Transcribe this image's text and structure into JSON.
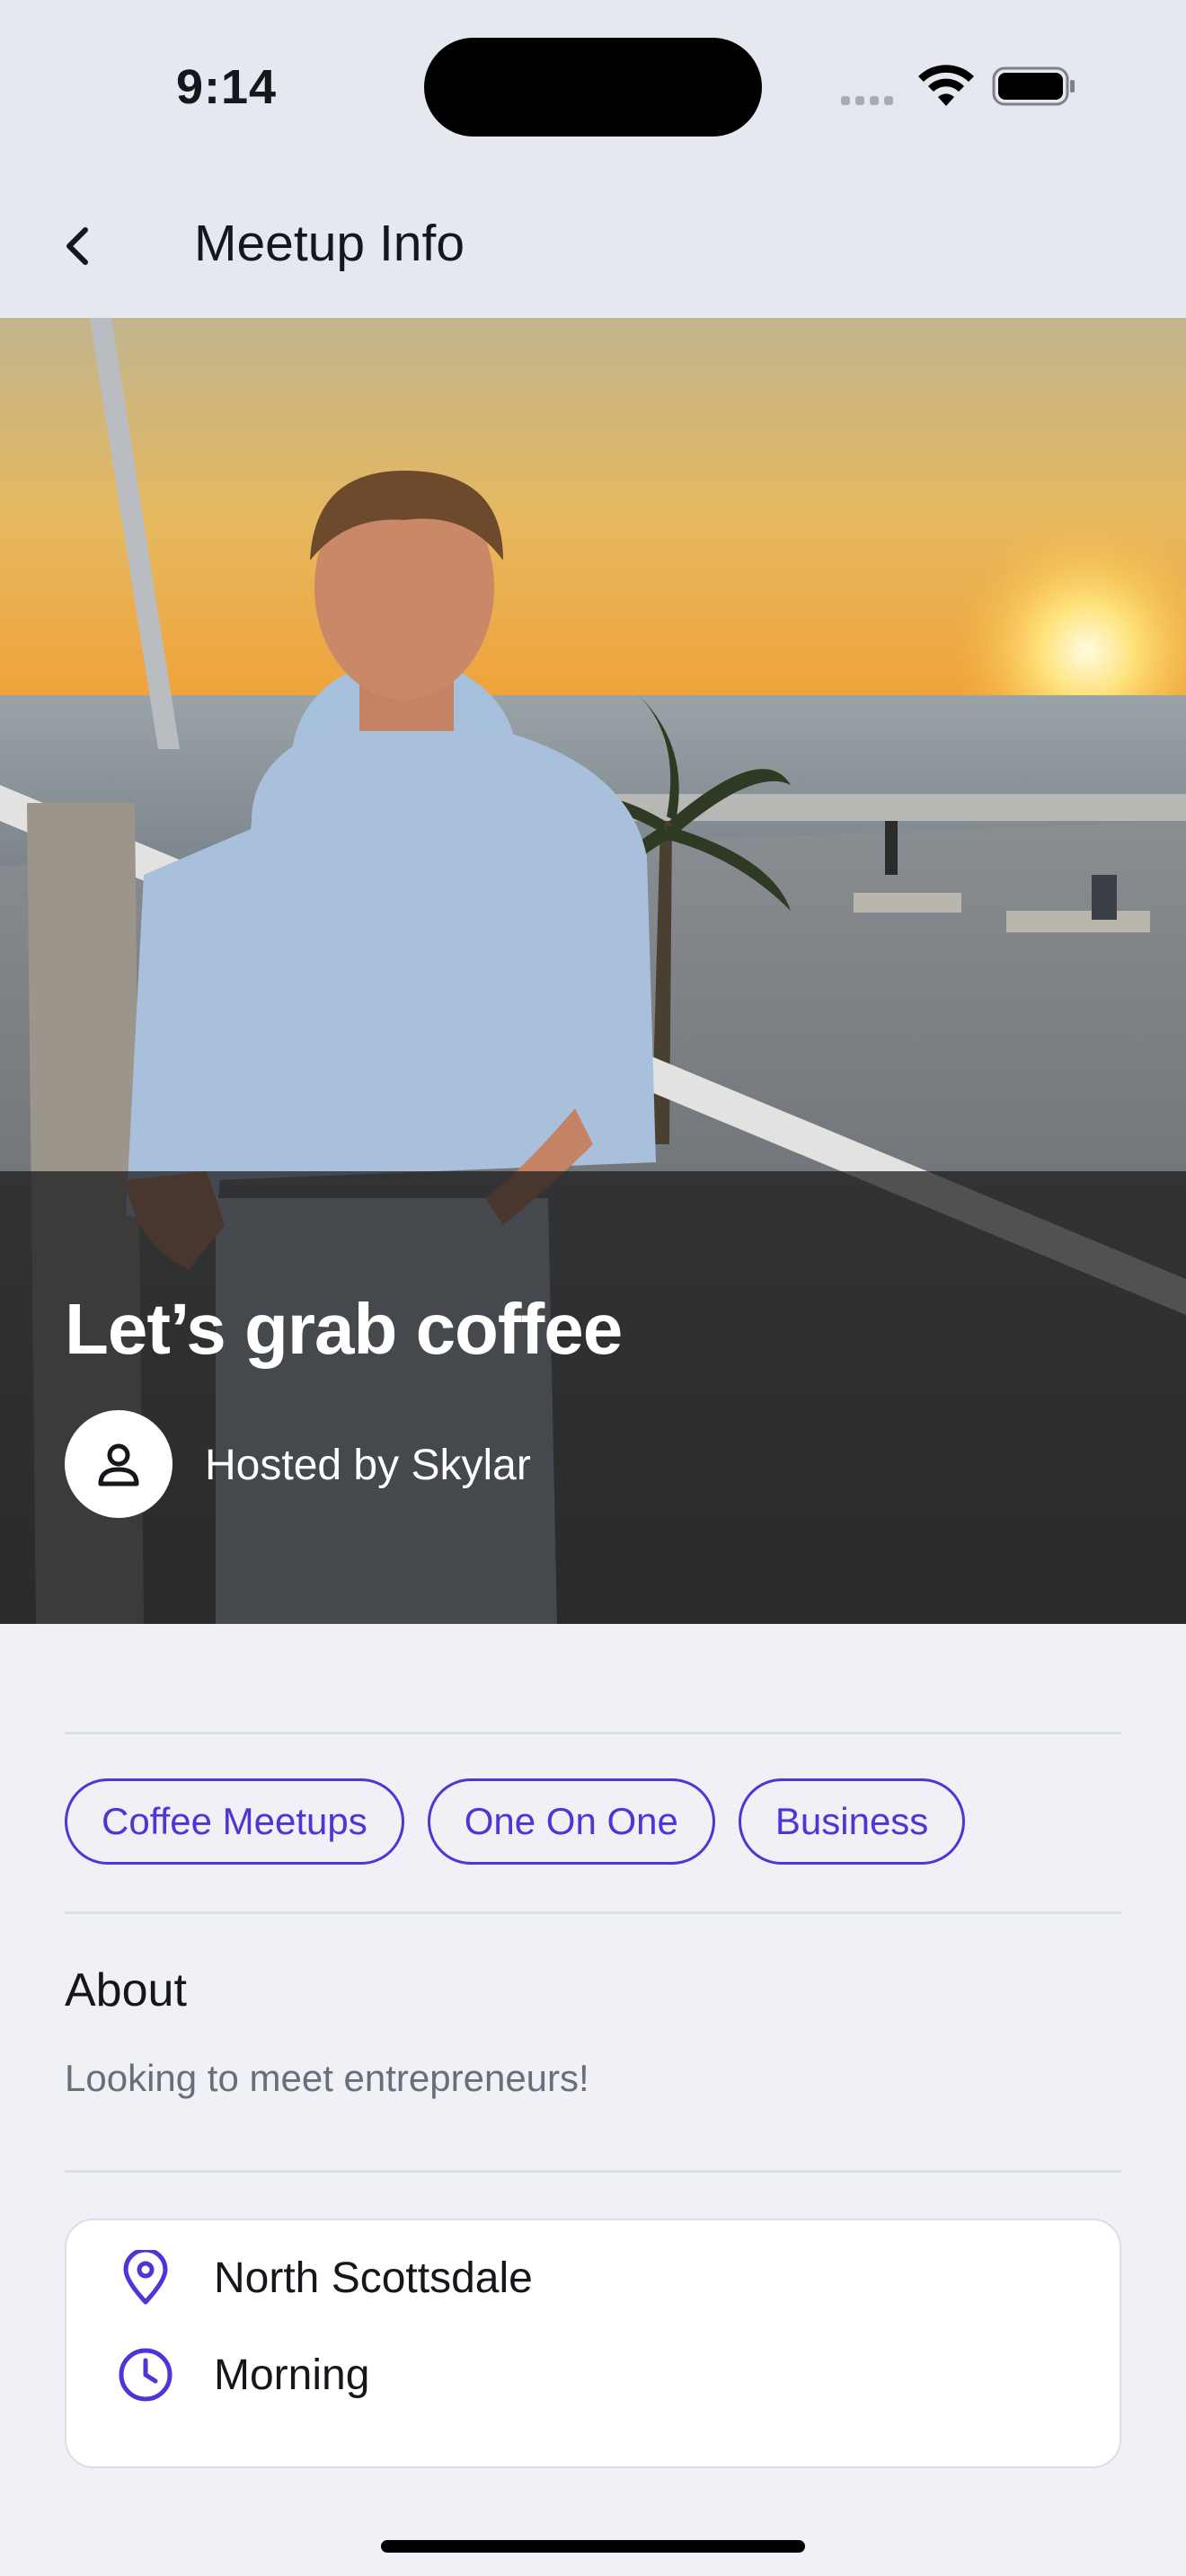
{
  "status_bar": {
    "time": "9:14"
  },
  "nav": {
    "title": "Meetup Info"
  },
  "meetup": {
    "title": "Let’s grab coffee",
    "host_label": "Hosted by Skylar"
  },
  "tags": [
    "Coffee Meetups",
    "One On One",
    "Business"
  ],
  "about": {
    "heading": "About",
    "text": "Looking to meet entrepreneurs!"
  },
  "details": {
    "location": "North Scottsdale",
    "time_of_day": "Morning"
  },
  "colors": {
    "accent": "#5133d6",
    "background": "#eff1f6",
    "overlay": "#191919"
  },
  "icons": {
    "back": "chevron-left-icon",
    "host": "person-icon",
    "location": "location-pin-icon",
    "time": "clock-icon"
  }
}
